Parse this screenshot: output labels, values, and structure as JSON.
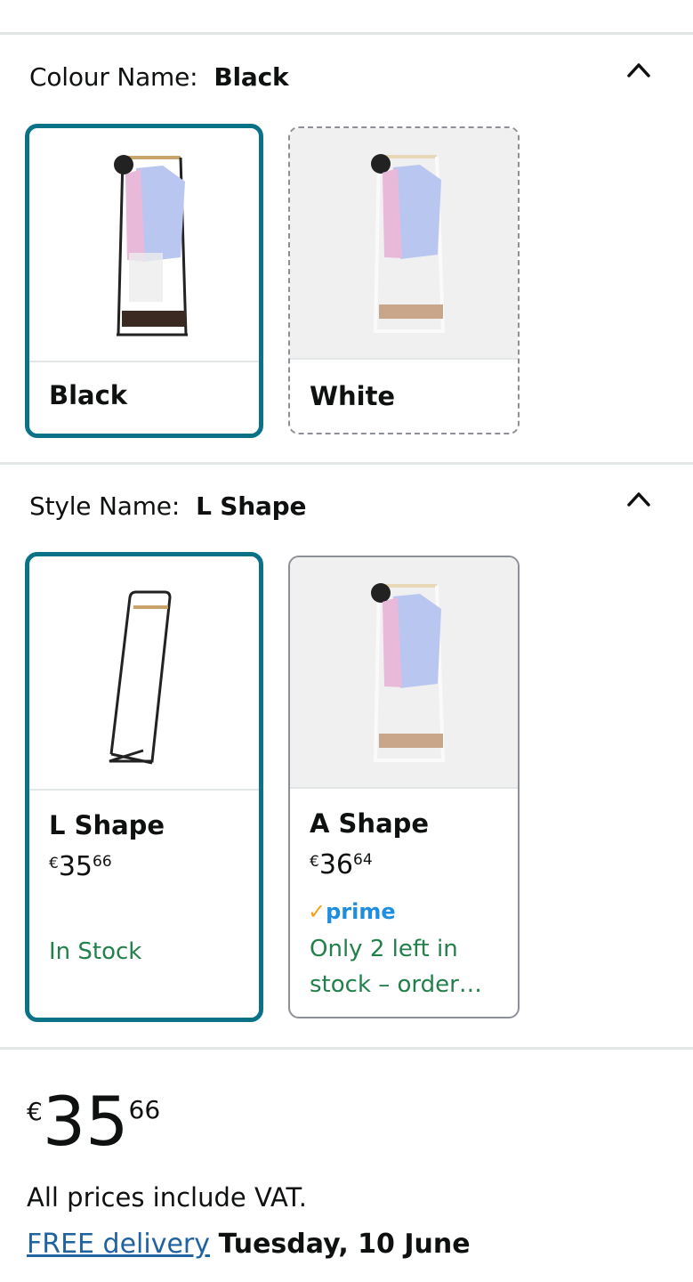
{
  "colour": {
    "label": "Colour Name:",
    "value": "Black",
    "options": [
      {
        "label": "Black",
        "state": "selected"
      },
      {
        "label": "White",
        "state": "unavailable"
      }
    ]
  },
  "style": {
    "label": "Style Name:",
    "value": "L Shape",
    "options": [
      {
        "label": "L Shape",
        "price_currency": "€",
        "price_whole": "35",
        "price_fraction": "66",
        "stock": "In Stock",
        "state": "selected"
      },
      {
        "label": "A Shape",
        "price_currency": "€",
        "price_whole": "36",
        "price_fraction": "64",
        "prime_check": "✓",
        "prime": "prime",
        "stock": "Only 2 left in stock – order…",
        "state": "available"
      }
    ]
  },
  "price": {
    "currency": "€",
    "whole": "35",
    "fraction": "66"
  },
  "vat_note": "All prices include VAT.",
  "delivery": {
    "link": "FREE delivery",
    "date": "Tuesday, 10 June"
  },
  "colors": {
    "accent": "#0a7287",
    "stock_green": "#23804a",
    "link": "#2162a1",
    "prime_blue": "#1d8ee0",
    "prime_orange": "#f7a21c"
  },
  "icons": [
    "chevron-up-icon",
    "clothes-rack-black-image",
    "clothes-rack-white-image",
    "l-shape-rack-image"
  ]
}
